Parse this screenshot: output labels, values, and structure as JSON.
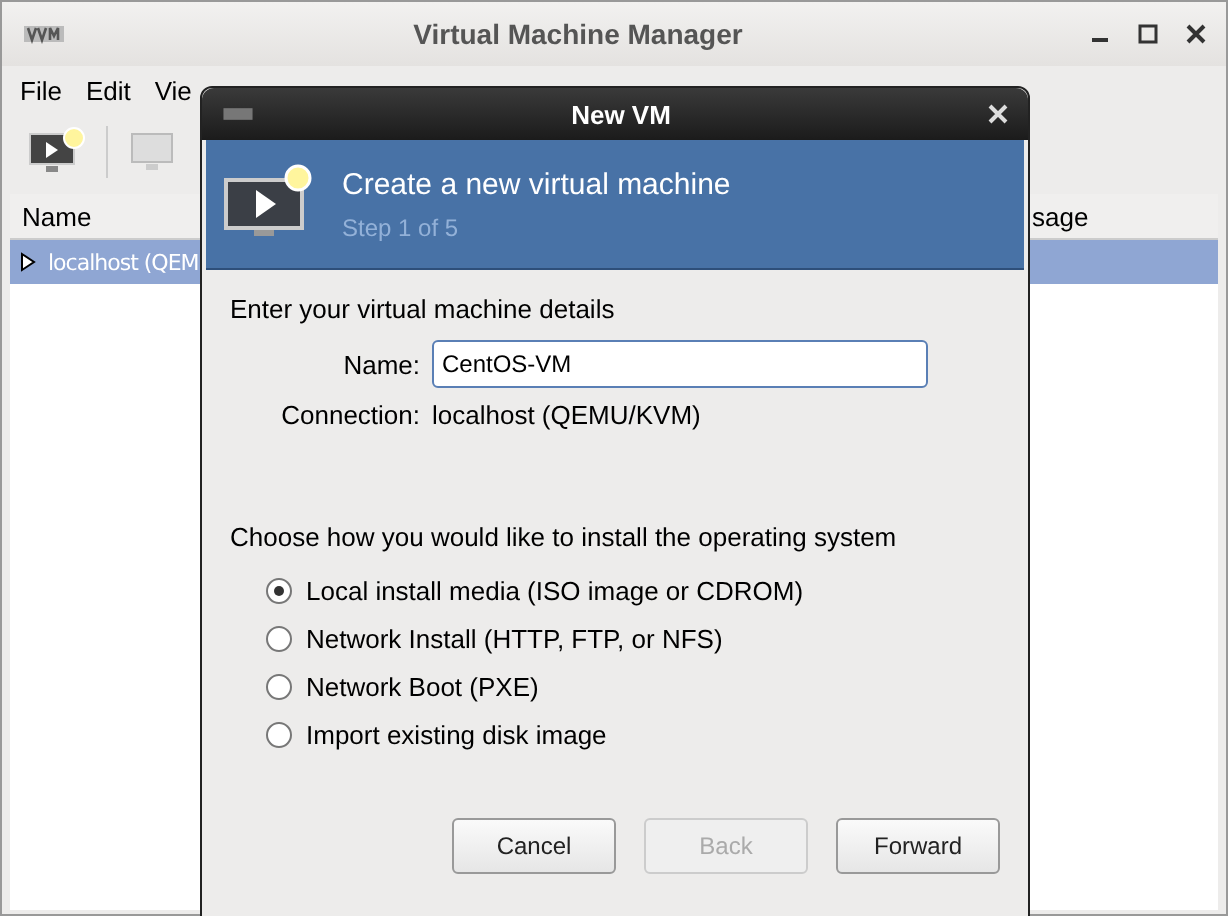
{
  "main_window": {
    "title": "Virtual Machine Manager",
    "menu": [
      "File",
      "Edit",
      "Vie"
    ],
    "table": {
      "columns": [
        "Name",
        "sage"
      ],
      "rows": [
        {
          "name": "localhost (QEM",
          "selected": true,
          "expanded": false
        }
      ]
    }
  },
  "dialog": {
    "title": "New VM",
    "heading": "Create a new virtual machine",
    "step": "Step 1 of 5",
    "details_label": "Enter your virtual machine details",
    "name_label": "Name:",
    "name_value": "CentOS-VM",
    "connection_label": "Connection:",
    "connection_value": "localhost (QEMU/KVM)",
    "install_label": "Choose how you would like to install the operating system",
    "options": [
      {
        "label": "Local install media (ISO image or CDROM)",
        "selected": true
      },
      {
        "label": "Network Install (HTTP, FTP, or NFS)",
        "selected": false
      },
      {
        "label": "Network Boot (PXE)",
        "selected": false
      },
      {
        "label": "Import existing disk image",
        "selected": false
      }
    ],
    "buttons": [
      {
        "label": "Cancel",
        "disabled": false
      },
      {
        "label": "Back",
        "disabled": true
      },
      {
        "label": "Forward",
        "disabled": false
      }
    ]
  }
}
